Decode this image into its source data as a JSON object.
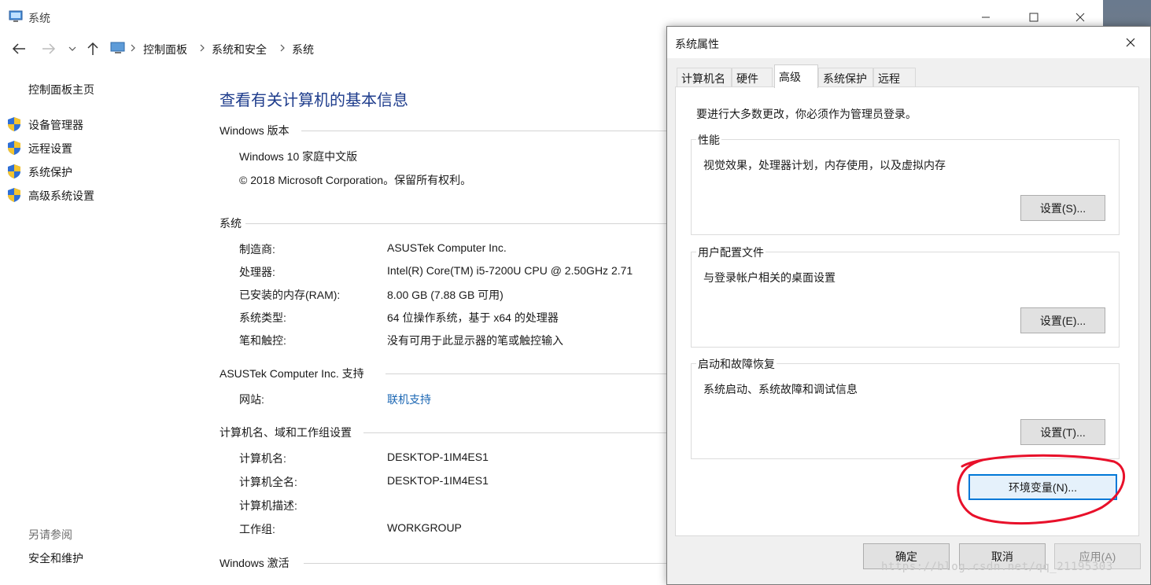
{
  "main_window": {
    "title": "系统",
    "breadcrumbs": [
      "控制面板",
      "系统和安全",
      "系统"
    ],
    "sidebar": {
      "home": "控制面板主页",
      "items": [
        "设备管理器",
        "远程设置",
        "系统保护",
        "高级系统设置"
      ],
      "see_also_heading": "另请参阅",
      "see_also_items": [
        "安全和维护"
      ]
    },
    "page_title": "查看有关计算机的基本信息",
    "windows_edition": {
      "heading": "Windows 版本",
      "edition": "Windows 10 家庭中文版",
      "copyright": "© 2018 Microsoft Corporation。保留所有权利。"
    },
    "system": {
      "heading": "系统",
      "rows": [
        {
          "label": "制造商:",
          "value": "ASUSTek Computer Inc."
        },
        {
          "label": "处理器:",
          "value": "Intel(R) Core(TM) i5-7200U CPU @ 2.50GHz   2.71"
        },
        {
          "label": "已安装的内存(RAM):",
          "value": "8.00 GB (7.88 GB 可用)"
        },
        {
          "label": "系统类型:",
          "value": "64 位操作系统，基于 x64 的处理器"
        },
        {
          "label": "笔和触控:",
          "value": "没有可用于此显示器的笔或触控输入"
        }
      ]
    },
    "support": {
      "heading": "ASUSTek Computer Inc. 支持",
      "website_label": "网站:",
      "website_link": "联机支持"
    },
    "computer_name": {
      "heading": "计算机名、域和工作组设置",
      "rows": [
        {
          "label": "计算机名:",
          "value": "DESKTOP-1IM4ES1"
        },
        {
          "label": "计算机全名:",
          "value": "DESKTOP-1IM4ES1"
        },
        {
          "label": "计算机描述:",
          "value": ""
        },
        {
          "label": "工作组:",
          "value": "WORKGROUP"
        }
      ]
    },
    "activation": {
      "heading": "Windows 激活"
    }
  },
  "dialog": {
    "title": "系统属性",
    "tabs": [
      "计算机名",
      "硬件",
      "高级",
      "系统保护",
      "远程"
    ],
    "active_tab": "高级",
    "admin_note": "要进行大多数更改，你必须作为管理员登录。",
    "performance": {
      "title": "性能",
      "desc": "视觉效果，处理器计划，内存使用，以及虚拟内存",
      "button": "设置(S)..."
    },
    "user_profiles": {
      "title": "用户配置文件",
      "desc": "与登录帐户相关的桌面设置",
      "button": "设置(E)..."
    },
    "startup_recovery": {
      "title": "启动和故障恢复",
      "desc": "系统启动、系统故障和调试信息",
      "button": "设置(T)..."
    },
    "env_button": "环境变量(N)...",
    "ok": "确定",
    "cancel": "取消",
    "apply": "应用(A)"
  },
  "watermark": "https://blog.csdn.net/qq_21195303",
  "colors": {
    "title_link_blue": "#1e3c8c",
    "hyperlink": "#1a66b3",
    "annotation_red": "#e8102a",
    "focus_blue": "#0078d7"
  }
}
